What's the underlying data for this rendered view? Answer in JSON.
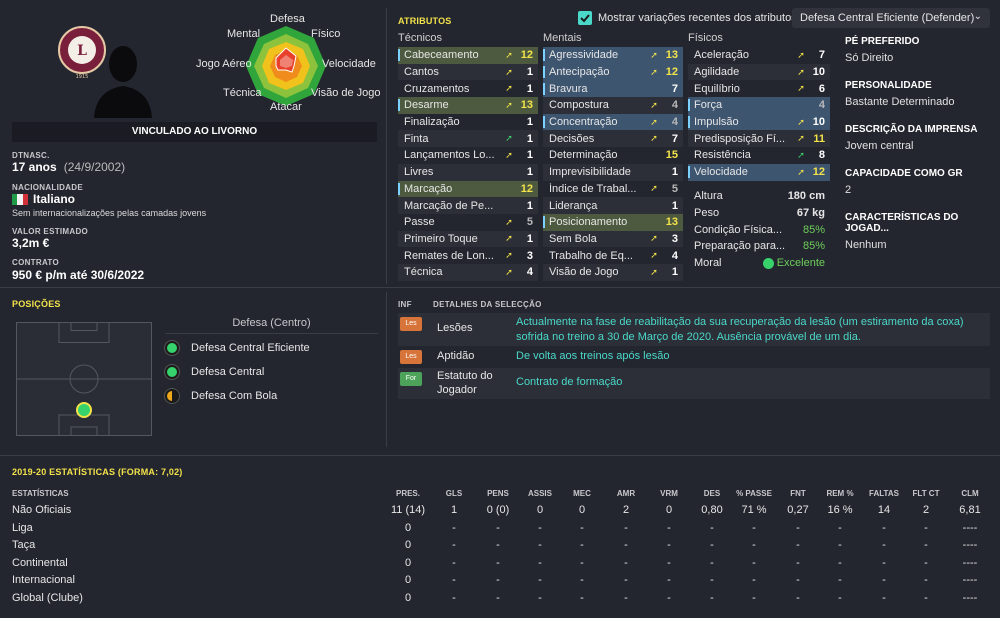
{
  "profile": {
    "contract_banner": "VINCULADO AO LIVORNO",
    "dob_label": "DTNASC.",
    "age": "17 anos",
    "dob": "(24/9/2002)",
    "nationality_label": "NACIONALIDADE",
    "nationality": "Italiano",
    "intl_note": "Sem internacionalizações pelas camadas jovens",
    "value_label": "VALOR ESTIMADO",
    "value": "3,2m €",
    "contract_label": "CONTRATO",
    "contract": "950 € p/m até 30/6/2022"
  },
  "radar": {
    "labels": {
      "defesa": "Defesa",
      "mental": "Mental",
      "fisico": "Físico",
      "jogo_aereo": "Jogo Aéreo",
      "velocidade": "Velocidade",
      "tecnica": "Técnica",
      "visao": "Visão de Jogo",
      "atacar": "Atacar"
    }
  },
  "attributes": {
    "title": "ATRIBUTOS",
    "show_changes_label": "Mostrar variações recentes dos atributos",
    "show_changes_checked": true,
    "role_select": "Defesa Central Eficiente (Defender)",
    "tecnicos_header": "Técnicos",
    "mentais_header": "Mentais",
    "fisicos_header": "Físicos",
    "tecnicos": [
      {
        "name": "Cabeceamento",
        "value": "12",
        "arrow": "up",
        "hl": "green",
        "color": "y"
      },
      {
        "name": "Cantos",
        "value": "1",
        "arrow": "up",
        "hl": "",
        "color": "w"
      },
      {
        "name": "Cruzamentos",
        "value": "1",
        "arrow": "up",
        "hl": "",
        "color": "w"
      },
      {
        "name": "Desarme",
        "value": "13",
        "arrow": "up",
        "hl": "green",
        "color": "y"
      },
      {
        "name": "Finalização",
        "value": "1",
        "arrow": "",
        "hl": "",
        "color": "w"
      },
      {
        "name": "Finta",
        "value": "1",
        "arrow": "green",
        "hl": "",
        "color": "w"
      },
      {
        "name": "Lançamentos Lo...",
        "value": "1",
        "arrow": "up",
        "hl": "",
        "color": "w"
      },
      {
        "name": "Livres",
        "value": "1",
        "arrow": "",
        "hl": "",
        "color": "w"
      },
      {
        "name": "Marcação",
        "value": "12",
        "arrow": "",
        "hl": "green",
        "color": "y"
      },
      {
        "name": "Marcação de Pe...",
        "value": "1",
        "arrow": "",
        "hl": "",
        "color": "w"
      },
      {
        "name": "Passe",
        "value": "5",
        "arrow": "up",
        "hl": "",
        "color": "g"
      },
      {
        "name": "Primeiro Toque",
        "value": "1",
        "arrow": "up",
        "hl": "",
        "color": "w"
      },
      {
        "name": "Remates de Lon...",
        "value": "3",
        "arrow": "up",
        "hl": "",
        "color": "w"
      },
      {
        "name": "Técnica",
        "value": "4",
        "arrow": "up",
        "hl": "",
        "color": "w"
      }
    ],
    "mentais": [
      {
        "name": "Agressividade",
        "value": "13",
        "arrow": "up",
        "hl": "blue",
        "color": "y"
      },
      {
        "name": "Antecipação",
        "value": "12",
        "arrow": "up",
        "hl": "blue",
        "color": "y"
      },
      {
        "name": "Bravura",
        "value": "7",
        "arrow": "",
        "hl": "blue",
        "color": "w"
      },
      {
        "name": "Compostura",
        "value": "4",
        "arrow": "up",
        "hl": "",
        "color": "g"
      },
      {
        "name": "Concentração",
        "value": "4",
        "arrow": "up",
        "hl": "blue",
        "color": "g"
      },
      {
        "name": "Decisões",
        "value": "7",
        "arrow": "up",
        "hl": "",
        "color": "w"
      },
      {
        "name": "Determinação",
        "value": "15",
        "arrow": "",
        "hl": "",
        "color": "y"
      },
      {
        "name": "Imprevisibilidade",
        "value": "1",
        "arrow": "",
        "hl": "",
        "color": "w"
      },
      {
        "name": "Índice de Trabal...",
        "value": "5",
        "arrow": "up",
        "hl": "",
        "color": "g"
      },
      {
        "name": "Liderança",
        "value": "1",
        "arrow": "",
        "hl": "",
        "color": "w"
      },
      {
        "name": "Posicionamento",
        "value": "13",
        "arrow": "",
        "hl": "green",
        "color": "y"
      },
      {
        "name": "Sem Bola",
        "value": "3",
        "arrow": "up",
        "hl": "",
        "color": "w"
      },
      {
        "name": "Trabalho de Eq...",
        "value": "4",
        "arrow": "up",
        "hl": "",
        "color": "w"
      },
      {
        "name": "Visão de Jogo",
        "value": "1",
        "arrow": "up",
        "hl": "",
        "color": "w"
      }
    ],
    "fisicos": [
      {
        "name": "Aceleração",
        "value": "7",
        "arrow": "up",
        "hl": "",
        "color": "w"
      },
      {
        "name": "Agilidade",
        "value": "10",
        "arrow": "up",
        "hl": "",
        "color": "w"
      },
      {
        "name": "Equilíbrio",
        "value": "6",
        "arrow": "up",
        "hl": "",
        "color": "w"
      },
      {
        "name": "Força",
        "value": "4",
        "arrow": "",
        "hl": "blue",
        "color": "g"
      },
      {
        "name": "Impulsão",
        "value": "10",
        "arrow": "up",
        "hl": "blue",
        "color": "w"
      },
      {
        "name": "Predisposição Fí...",
        "value": "11",
        "arrow": "up",
        "hl": "",
        "color": "y"
      },
      {
        "name": "Resistência",
        "value": "8",
        "arrow": "green",
        "hl": "",
        "color": "w"
      },
      {
        "name": "Velocidade",
        "value": "12",
        "arrow": "up",
        "hl": "blue",
        "color": "y"
      }
    ],
    "physical_stats": [
      {
        "label": "Altura",
        "value": "180 cm"
      },
      {
        "label": "Peso",
        "value": "67 kg"
      },
      {
        "label": "Condição Física...",
        "value": "85%"
      },
      {
        "label": "Preparação para...",
        "value": "85%"
      },
      {
        "label": "Moral",
        "value": "Excelente"
      }
    ]
  },
  "info_panel": {
    "foot_h": "PÉ PREFERIDO",
    "foot_v": "Só Direito",
    "pers_h": "PERSONALIDADE",
    "pers_v": "Bastante Determinado",
    "press_h": "DESCRIÇÃO DA IMPRENSA",
    "press_v": "Jovem central",
    "gk_h": "CAPACIDADE COMO GR",
    "gk_v": "2",
    "traits_h": "CARACTERÍSTICAS DO JOGAD...",
    "traits_v": "Nenhum"
  },
  "positions": {
    "title": "POSIÇÕES",
    "group": "Defesa (Centro)",
    "roles": [
      "Defesa Central Eficiente",
      "Defesa Central",
      "Defesa Com Bola"
    ]
  },
  "selection": {
    "inf_header": "INF",
    "details_header": "DETALHES DA SELECÇÃO",
    "rows": [
      {
        "badge": "Les",
        "label": "Lesões",
        "text": "Actualmente na fase de reabilitação da sua recuperação da lesão (um estiramento da coxa) sofrida no treino a 30 de Março de 2020. Ausência provável de um dia."
      },
      {
        "badge": "Les",
        "label": "Aptidão",
        "text": "De volta aos treinos após lesão"
      },
      {
        "badge": "For",
        "label": "Estatuto do Jogador",
        "text": "Contrato de formação"
      }
    ]
  },
  "stats": {
    "title": "2019-20 ESTATÍSTICAS (FORMA: 7,02)",
    "headers": [
      "ESTATÍSTICAS",
      "PRES.",
      "GLS",
      "PENS",
      "ASSIS",
      "MEC",
      "AMR",
      "VRM",
      "DES",
      "% PASSE",
      "FNT",
      "REM %",
      "FALTAS",
      "FLT CT",
      "CLM"
    ],
    "rows": [
      [
        "Não Oficiais",
        "11 (14)",
        "1",
        "0 (0)",
        "0",
        "0",
        "2",
        "0",
        "0,80",
        "71 %",
        "0,27",
        "16 %",
        "14",
        "2",
        "6,81"
      ],
      [
        "Liga",
        "0",
        "-",
        "-",
        "-",
        "-",
        "-",
        "-",
        "-",
        "-",
        "-",
        "-",
        "-",
        "-",
        "----"
      ],
      [
        "Taça",
        "0",
        "-",
        "-",
        "-",
        "-",
        "-",
        "-",
        "-",
        "-",
        "-",
        "-",
        "-",
        "-",
        "----"
      ],
      [
        "Continental",
        "0",
        "-",
        "-",
        "-",
        "-",
        "-",
        "-",
        "-",
        "-",
        "-",
        "-",
        "-",
        "-",
        "----"
      ],
      [
        "Internacional",
        "0",
        "-",
        "-",
        "-",
        "-",
        "-",
        "-",
        "-",
        "-",
        "-",
        "-",
        "-",
        "-",
        "----"
      ],
      [
        "Global (Clube)",
        "0",
        "-",
        "-",
        "-",
        "-",
        "-",
        "-",
        "-",
        "-",
        "-",
        "-",
        "-",
        "-",
        "----"
      ]
    ]
  }
}
